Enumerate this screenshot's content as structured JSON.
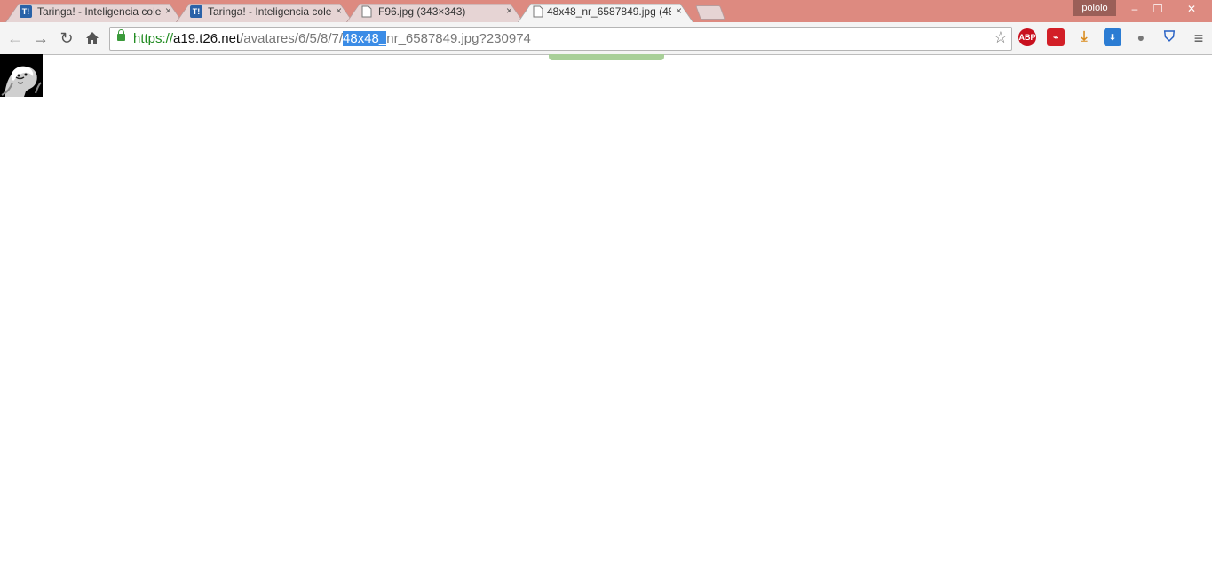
{
  "tabs": [
    {
      "title": "Taringa! - Inteligencia cole",
      "favicon": "taringa-icon"
    },
    {
      "title": "Taringa! - Inteligencia cole",
      "favicon": "taringa-icon"
    },
    {
      "title": "F96.jpg (343×343)",
      "favicon": "page-icon"
    },
    {
      "title": "48x48_nr_6587849.jpg (48",
      "favicon": "page-icon",
      "active": true
    }
  ],
  "profile": {
    "name": "pololo"
  },
  "window": {
    "minimize": "–",
    "restore": "❐",
    "close": "✕"
  },
  "address": {
    "scheme": "https://",
    "host": "a19.t26.net",
    "path_before": "/avatares/6/5/8/7/",
    "selected": "48x48_",
    "path_after": "nr_6587849.jpg?230974"
  },
  "extensions": [
    {
      "name": "adblock-plus-icon",
      "label": "ABP",
      "color": "#c8101e"
    },
    {
      "name": "pdf-icon",
      "label": "",
      "color": "#d21f27"
    },
    {
      "name": "download-icon",
      "label": "",
      "color": "#d98a1b"
    },
    {
      "name": "download-manager-icon",
      "label": "",
      "color": "#2b7cd3"
    },
    {
      "name": "extension-icon",
      "label": "",
      "color": "#777777"
    },
    {
      "name": "shield-icon",
      "label": "",
      "color": "#2760c4"
    }
  ],
  "tab_close_glyph": "×"
}
